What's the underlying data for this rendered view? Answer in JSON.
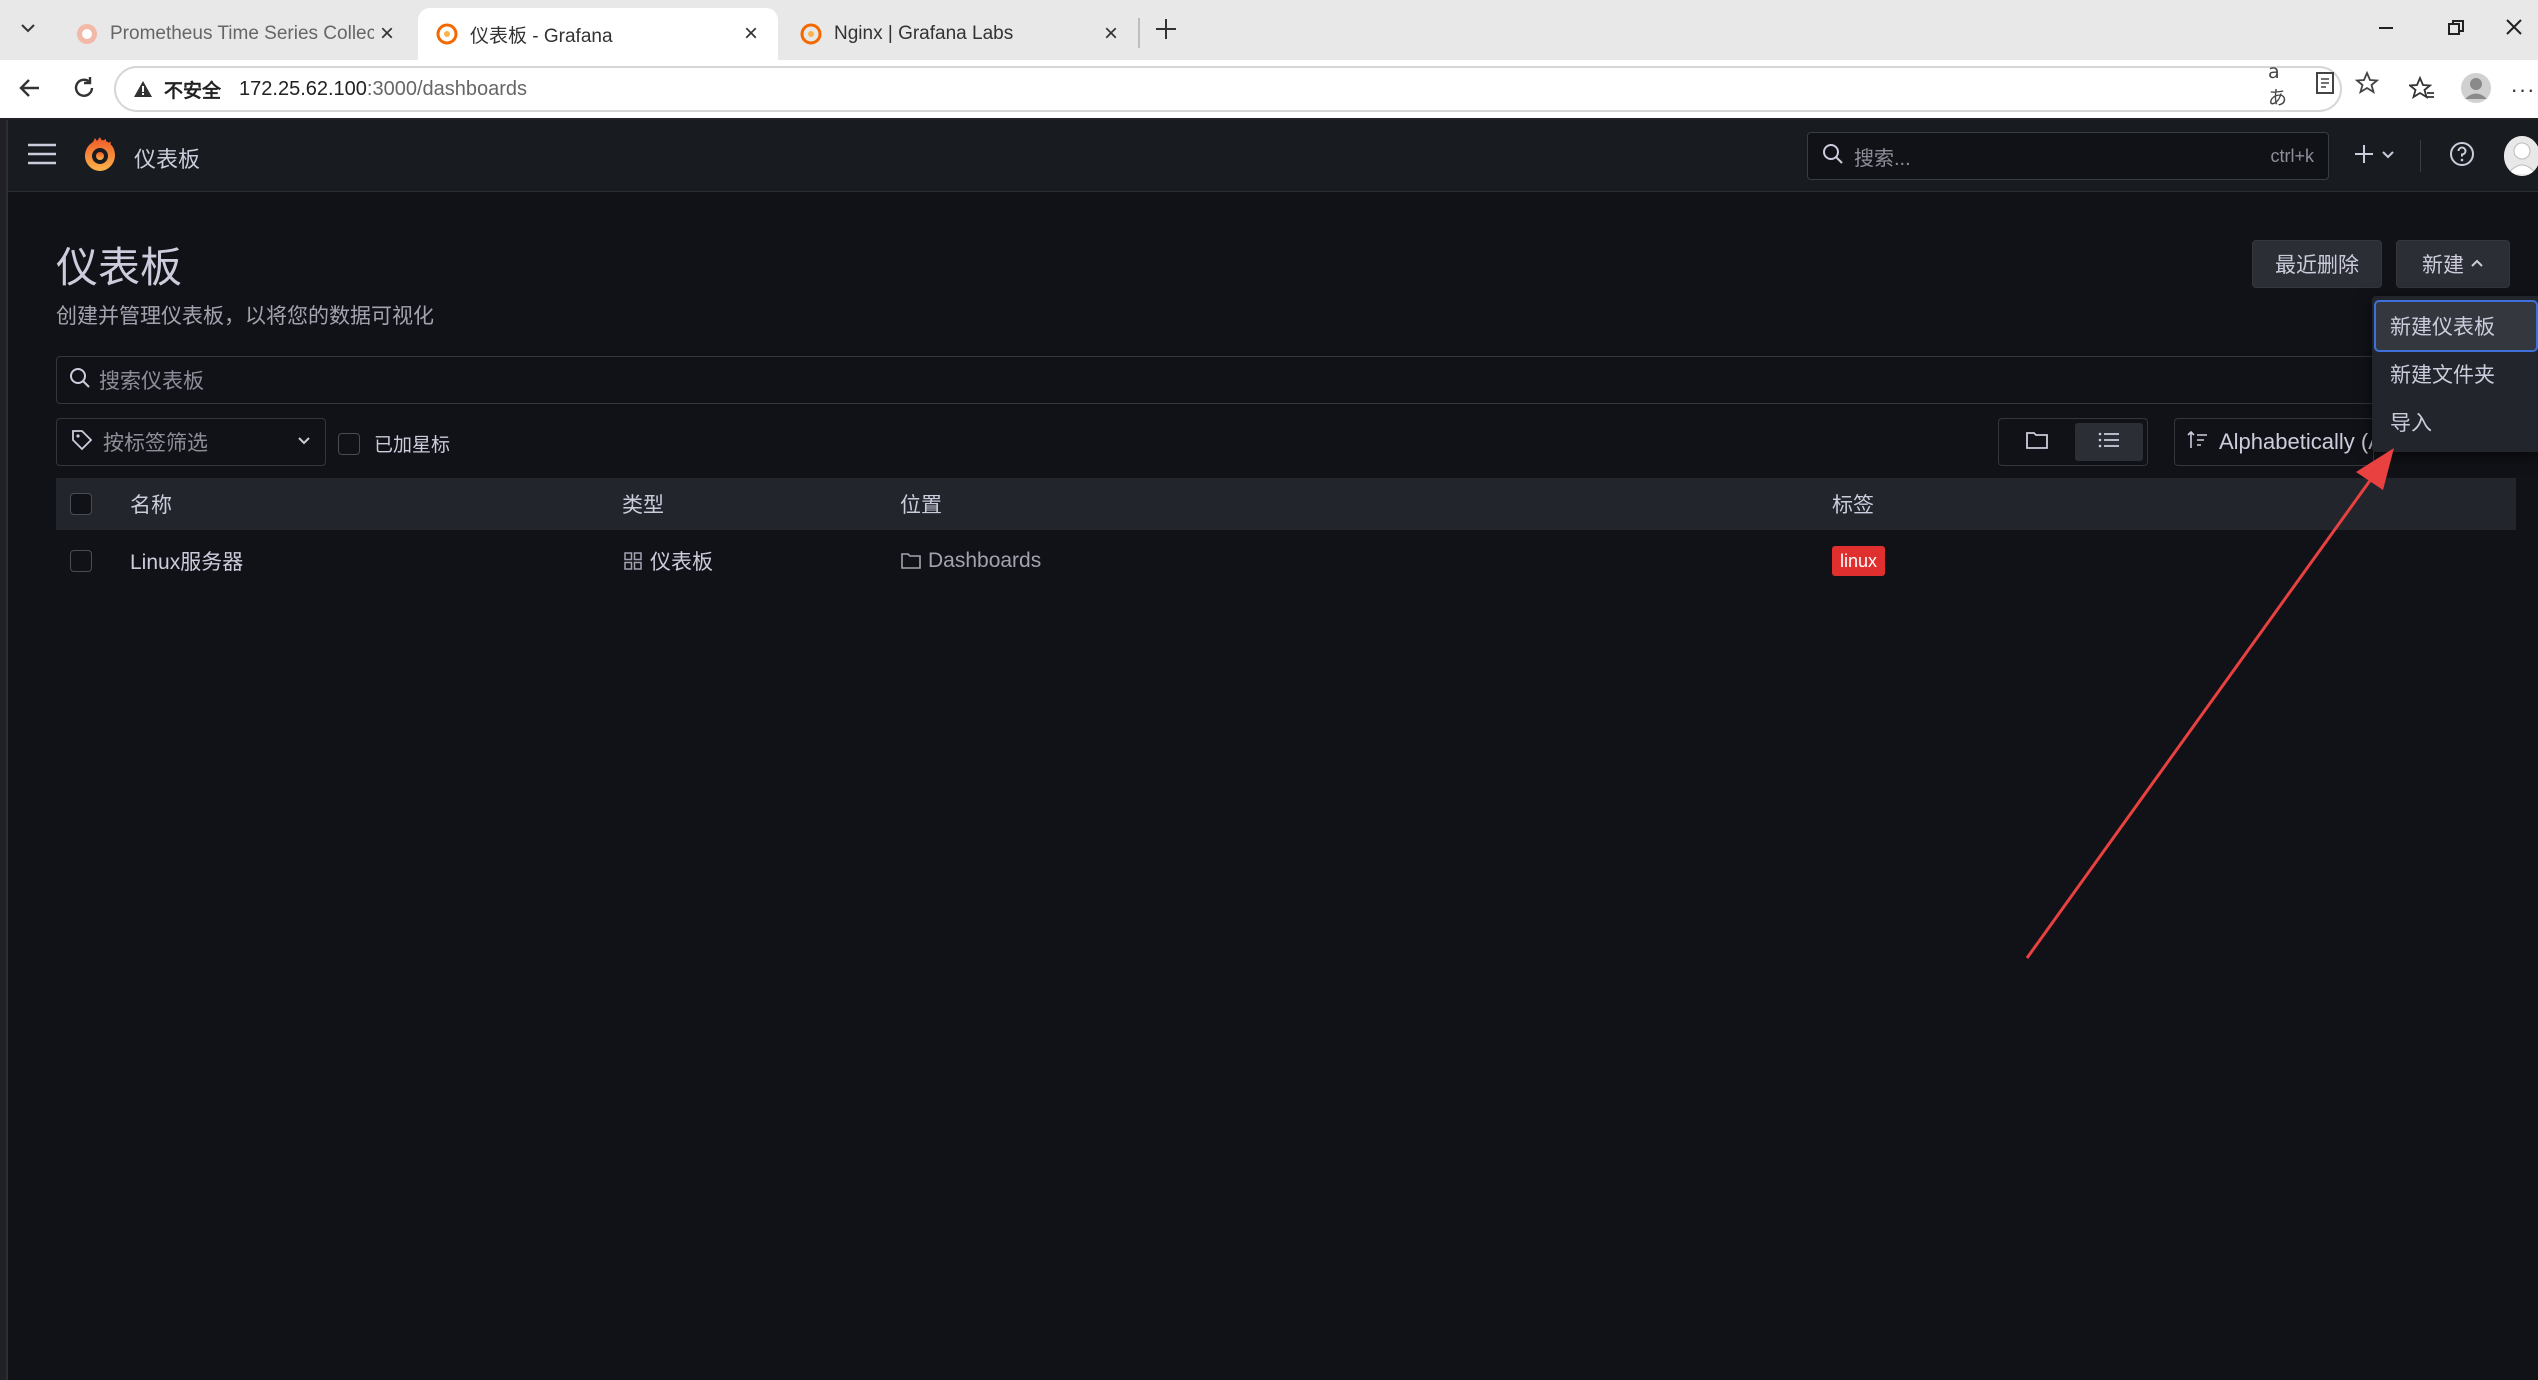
{
  "browser": {
    "tabs": [
      {
        "title": "Prometheus Time Series Collection",
        "active": false
      },
      {
        "title": "仪表板 - Grafana",
        "active": true
      },
      {
        "title": "Nginx | Grafana Labs",
        "active": false
      }
    ],
    "address": {
      "security_label": "不安全",
      "host": "172.25.62.100",
      "path": ":3000/dashboards"
    }
  },
  "topnav": {
    "breadcrumb": "仪表板",
    "search_placeholder": "搜索...",
    "search_shortcut": "ctrl+k"
  },
  "page": {
    "title": "仪表板",
    "subtitle": "创建并管理仪表板，以将您的数据可视化",
    "recently_deleted": "最近删除",
    "new_button": "新建",
    "search_placeholder": "搜索仪表板",
    "tag_filter": "按标签筛选",
    "starred_label": "已加星标",
    "sort_label": "Alphabetically (A–Z)"
  },
  "new_menu": {
    "items": [
      "新建仪表板",
      "新建文件夹",
      "导入"
    ]
  },
  "table": {
    "headers": {
      "name": "名称",
      "type": "类型",
      "location": "位置",
      "tags": "标签"
    },
    "rows": [
      {
        "name": "Linux服务器",
        "type": "仪表板",
        "location": "Dashboards",
        "tag": "linux"
      }
    ]
  },
  "colors": {
    "accent": "#3d71d9",
    "tag_red": "#e02f2f",
    "annotation_arrow": "#e8413f"
  }
}
